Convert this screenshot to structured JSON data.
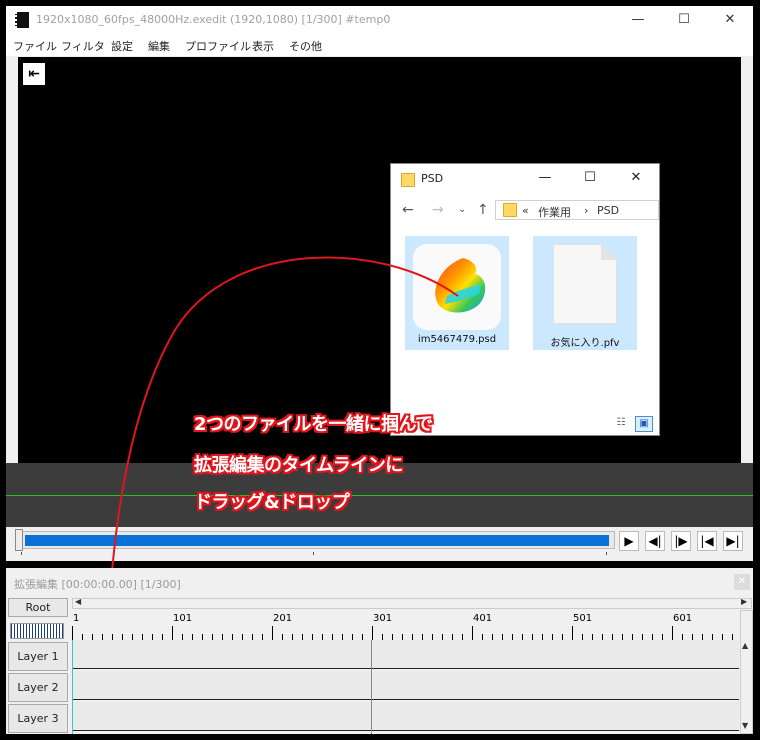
{
  "main": {
    "title": "1920x1080_60fps_48000Hz.exedit  (1920,1080)  [1/300]  #temp0",
    "window_buttons": {
      "minimize": "—",
      "maximize": "☐",
      "close": "✕"
    },
    "menu": [
      "ファイル",
      "フィルタ",
      "設定",
      "編集",
      "プロファイル",
      "表示",
      "その他"
    ],
    "back_icon": "⇤",
    "seek_progress": 1.0,
    "controls": [
      "▶",
      "◀|",
      "|▶",
      "|◀",
      "▶|"
    ]
  },
  "explorer": {
    "title": "PSD",
    "window_buttons": {
      "minimize": "—",
      "maximize": "☐",
      "close": "✕"
    },
    "nav": {
      "back": "←",
      "forward": "→",
      "recent": "⌄",
      "up": "↑"
    },
    "address": {
      "prefix": "«",
      "parent": "作業用",
      "sep": "›",
      "current": "PSD"
    },
    "files": [
      {
        "name": "im5467479.psd",
        "icon": "medibang-icon"
      },
      {
        "name": "お気に入り.pfv",
        "icon": "blank-file-icon"
      }
    ],
    "view_icons": {
      "details": "☷",
      "large": "▣"
    }
  },
  "annotation": {
    "lines": [
      "2つのファイルを一緒に掴んで",
      "拡張編集のタイムラインに",
      "ドラッグ&ドロップ"
    ],
    "color": "#e0161d"
  },
  "timeline": {
    "title": "拡張編集 [00:00:00.00] [1/300]",
    "close": "✕",
    "root_label": "Root",
    "ruler_labels": [
      "1",
      "101",
      "201",
      "301",
      "401",
      "501",
      "601"
    ],
    "layers": [
      "Layer 1",
      "Layer 2",
      "Layer 3"
    ],
    "scroll": {
      "left": "◀",
      "right": "▶",
      "up": "▲",
      "down": "▼"
    }
  }
}
